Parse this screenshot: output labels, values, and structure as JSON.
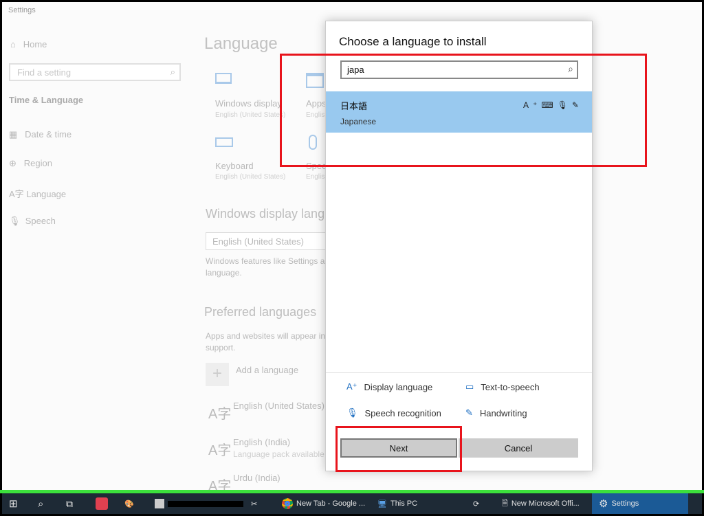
{
  "window": {
    "title": "Settings"
  },
  "sidebar": {
    "home": "Home",
    "search_placeholder": "Find a setting",
    "section": "Time & Language",
    "items": [
      {
        "label": "Date & time",
        "icon": "calendar-clock-icon"
      },
      {
        "label": "Region",
        "icon": "globe-icon"
      },
      {
        "label": "Language",
        "icon": "language-icon"
      },
      {
        "label": "Speech",
        "icon": "microphone-icon"
      }
    ]
  },
  "main": {
    "title": "Language",
    "tiles": [
      {
        "label": "Windows display",
        "sub": "English (United States)"
      },
      {
        "label": "Apps",
        "sub": "English"
      },
      {
        "label": "Keyboard",
        "sub": "English (United States)"
      },
      {
        "label": "Speech",
        "sub": "English"
      }
    ],
    "display_heading": "Windows display language",
    "display_value": "English (United States)",
    "display_note1": "Windows features like Settings a",
    "display_note2": "language.",
    "pref_heading": "Preferred languages",
    "pref_note1": "Apps and websites will appear in",
    "pref_note2": "support.",
    "add_language": "Add a language",
    "languages": [
      {
        "name": "English (United States)",
        "status": ""
      },
      {
        "name": "English (India)",
        "status": "Language pack available"
      },
      {
        "name": "Urdu (India)",
        "status": ""
      }
    ]
  },
  "dialog": {
    "title": "Choose a language to install",
    "search_value": "japa",
    "results": [
      {
        "native": "日本語",
        "english": "Japanese",
        "selected": true
      }
    ],
    "features": [
      "Display language",
      "Text-to-speech",
      "Speech recognition",
      "Handwriting"
    ],
    "next": "Next",
    "cancel": "Cancel"
  },
  "taskbar": {
    "items": [
      "New Tab - Google ...",
      "This PC",
      "New Microsoft Offi...",
      "Settings"
    ]
  },
  "colors": {
    "selection": "#99c9ef",
    "highlight_box": "#e8141c",
    "taskbar": "#1e2a36",
    "active_task": "#1b5a96"
  }
}
